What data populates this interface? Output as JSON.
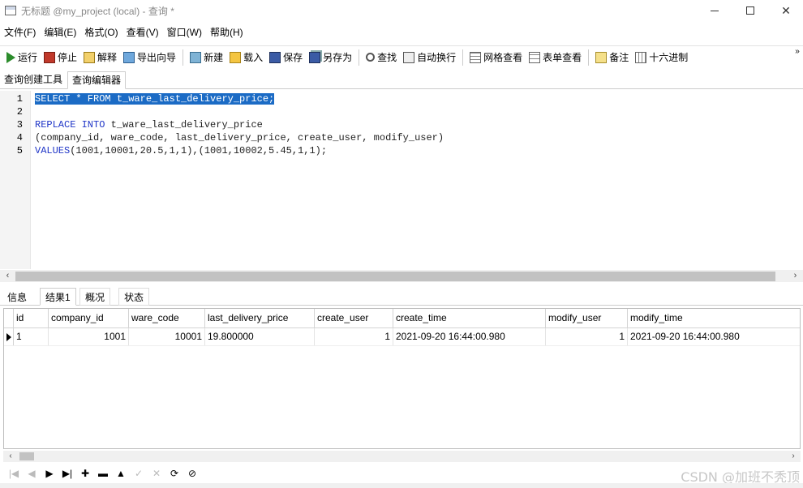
{
  "window": {
    "title": "无标题 @my_project (local) - 查询 *"
  },
  "menu": [
    "文件(F)",
    "编辑(E)",
    "格式(O)",
    "查看(V)",
    "窗口(W)",
    "帮助(H)"
  ],
  "toolbar": {
    "run": "运行",
    "stop": "停止",
    "explain": "解释",
    "export_wizard": "导出向导",
    "new": "新建",
    "load": "载入",
    "save": "保存",
    "save_as": "另存为",
    "find": "查找",
    "word_wrap": "自动换行",
    "grid_view": "网格查看",
    "form_view": "表单查看",
    "note": "备注",
    "hex": "十六进制",
    "more": "»"
  },
  "top_tabs": [
    "查询创建工具",
    "查询编辑器"
  ],
  "editor": {
    "line_numbers": [
      "1",
      "2",
      "3",
      "4",
      "5"
    ],
    "lines": {
      "l1": "SELECT * FROM t_ware_last_delivery_price;",
      "l3_kw": "REPLACE INTO",
      "l3_rest": " t_ware_last_delivery_price",
      "l4": "(company_id, ware_code, last_delivery_price, create_user, modify_user)",
      "l5_kw": "VALUES",
      "l5_rest": "(1001,10001,20.5,1,1),(1001,10002,5.45,1,1);"
    },
    "colors": {
      "keyword": "#1f35c7",
      "selection": "#1b6bc5"
    }
  },
  "result_tabs": [
    "信息",
    "结果1",
    "概况",
    "状态"
  ],
  "grid": {
    "columns": [
      "id",
      "company_id",
      "ware_code",
      "last_delivery_price",
      "create_user",
      "create_time",
      "modify_user",
      "modify_time"
    ],
    "rows": [
      [
        "1",
        "1001",
        "10001",
        "19.800000",
        "1",
        "2021-09-20 16:44:00.980",
        "1",
        "2021-09-20 16:44:00.980"
      ]
    ]
  },
  "nav": {
    "first": "|◀",
    "prev": "◀",
    "next": "▶",
    "last": "▶|",
    "add": "✚",
    "delete": "▬",
    "up": "▲",
    "apply": "✓",
    "discard": "✕",
    "refresh": "⟳",
    "stop": "⊘"
  },
  "watermark": "CSDN @加班不秃顶"
}
